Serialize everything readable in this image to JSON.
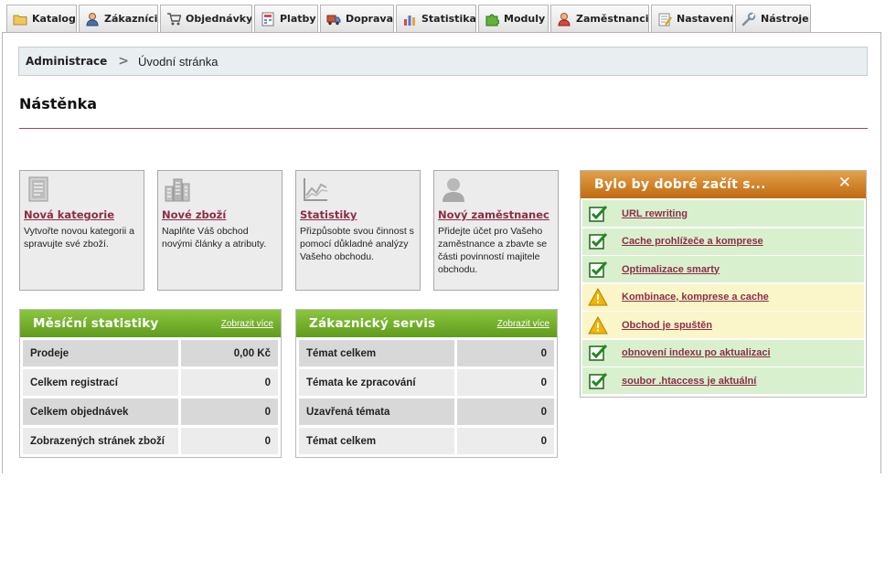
{
  "tabs": [
    {
      "label": "Katalog",
      "icon": "folder-icon"
    },
    {
      "label": "Zákazníci",
      "icon": "customer-icon"
    },
    {
      "label": "Objednávky",
      "icon": "cart-icon"
    },
    {
      "label": "Platby",
      "icon": "payment-icon"
    },
    {
      "label": "Doprava",
      "icon": "truck-icon"
    },
    {
      "label": "Statistika",
      "icon": "bar-chart-icon"
    },
    {
      "label": "Moduly",
      "icon": "puzzle-icon"
    },
    {
      "label": "Zaměstnanci",
      "icon": "employee-icon"
    },
    {
      "label": "Nastavení",
      "icon": "settings-icon"
    },
    {
      "label": "Nástroje",
      "icon": "wrench-icon"
    }
  ],
  "breadcrumb": {
    "root": "Administrace",
    "separator": ">",
    "current": "Úvodní stránka"
  },
  "page": {
    "title": "Nástěnka"
  },
  "quick_boxes": [
    {
      "link": "Nová kategorie",
      "description": "Vytvořte novou kategorii a spravujte své zboží.",
      "icon": "document-icon"
    },
    {
      "link": "Nové zboží",
      "description": "Naplňte Váš obchod novými články a atributy.",
      "icon": "buildings-icon"
    },
    {
      "link": "Statistiky",
      "description": "Přizpůsobte svou činnost s pomocí důkladné analýzy Vašeho obchodu.",
      "icon": "line-chart-icon"
    },
    {
      "link": "Nový zaměstnanec",
      "description": "Přidejte účet pro Vašeho zaměstnance a zbavte se části povinností majitele obchodu.",
      "icon": "person-icon"
    }
  ],
  "monthly_stats": {
    "title": "Měsíční statistiky",
    "more_link": "Zobrazit více",
    "rows": [
      {
        "label": "Prodeje",
        "value": "0,00 Kč"
      },
      {
        "label": "Celkem registrací",
        "value": "0"
      },
      {
        "label": "Celkem objednávek",
        "value": "0"
      },
      {
        "label": "Zobrazených stránek zboží",
        "value": "0"
      }
    ]
  },
  "customer_service": {
    "title": "Zákaznický servis",
    "more_link": "Zobrazit více",
    "rows": [
      {
        "label": "Témat celkem",
        "value": "0"
      },
      {
        "label": "Témata ke zpracování",
        "value": "0"
      },
      {
        "label": "Uzavřená témata",
        "value": "0"
      },
      {
        "label": "Témat celkem",
        "value": "0"
      }
    ]
  },
  "getting_started": {
    "title": "Bylo by dobré začít s...",
    "close_label": "✕",
    "items": [
      {
        "label": "URL rewriting",
        "status": "ok"
      },
      {
        "label": "Cache prohlížeče a komprese",
        "status": "ok"
      },
      {
        "label": "Optimalizace smarty",
        "status": "ok"
      },
      {
        "label": "Kombinace, komprese a cache",
        "status": "warning"
      },
      {
        "label": "Obchod je spuštěn",
        "status": "warning"
      },
      {
        "label": "obnovení indexu po aktualizaci",
        "status": "ok"
      },
      {
        "label": "soubor .htaccess je aktuální",
        "status": "ok"
      }
    ]
  },
  "colors": {
    "accent_link": "#8b2e45",
    "panel_green": "#6aa827",
    "panel_orange": "#d4872a",
    "ok_row": "#d9f0cf",
    "warn_row": "#fbf6c9"
  }
}
